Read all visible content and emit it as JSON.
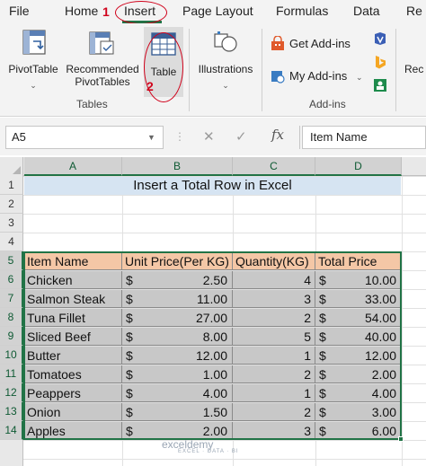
{
  "ribbon": {
    "tabs": [
      {
        "label": "File"
      },
      {
        "label": "Home"
      },
      {
        "label": "Insert"
      },
      {
        "label": "Page Layout"
      },
      {
        "label": "Formulas"
      },
      {
        "label": "Data"
      },
      {
        "label": "Re"
      }
    ],
    "active_tab": "Insert",
    "step1": "1",
    "step2": "2",
    "buttons": {
      "pivottable": "PivotTable",
      "recommended_l1": "Recommended",
      "recommended_l2": "PivotTables",
      "table": "Table",
      "illustrations": "Illustrations",
      "get_addins": "Get Add-ins",
      "my_addins": "My Add-ins",
      "rec": "Rec"
    },
    "groups": {
      "tables": "Tables",
      "addins": "Add-ins"
    },
    "icons": {
      "pivottable": "pivottable-icon",
      "recommended": "recommended-pivottables-icon",
      "table": "table-icon",
      "illustrations": "illustrations-icon",
      "get_addins": "store-icon",
      "my_addins": "my-addins-icon",
      "visio": "visio-icon",
      "bing": "bing-maps-icon",
      "people": "people-graph-icon"
    }
  },
  "formula_bar": {
    "name_box": "A5",
    "cancel_icon": "✕",
    "enter_icon": "✓",
    "fx_label": "fx",
    "formula": "Item Name"
  },
  "grid": {
    "columns": [
      "A",
      "B",
      "C",
      "D"
    ],
    "rows": [
      "1",
      "2",
      "3",
      "4",
      "5",
      "6",
      "7",
      "8",
      "9",
      "10",
      "11",
      "12",
      "13",
      "14"
    ],
    "title": "Insert a Total Row in Excel",
    "headers": [
      "Item Name",
      "Unit Price(Per KG)",
      "Quantity(KG)",
      "Total Price"
    ],
    "currency": "$",
    "data": [
      {
        "item": "Chicken",
        "price": "2.50",
        "qty": "4",
        "total": "10.00"
      },
      {
        "item": "Salmon Steak",
        "price": "11.00",
        "qty": "3",
        "total": "33.00"
      },
      {
        "item": "Tuna Fillet",
        "price": "27.00",
        "qty": "2",
        "total": "54.00"
      },
      {
        "item": "Sliced Beef",
        "price": "8.00",
        "qty": "5",
        "total": "40.00"
      },
      {
        "item": "Butter",
        "price": "12.00",
        "qty": "1",
        "total": "12.00"
      },
      {
        "item": "Tomatoes",
        "price": "1.00",
        "qty": "2",
        "total": "2.00"
      },
      {
        "item": "Peappers",
        "price": "4.00",
        "qty": "1",
        "total": "4.00"
      },
      {
        "item": "Onion",
        "price": "1.50",
        "qty": "2",
        "total": "3.00"
      },
      {
        "item": "Apples",
        "price": "2.00",
        "qty": "3",
        "total": "6.00"
      }
    ]
  },
  "watermark": {
    "brand": "exceldemy",
    "tagline": "EXCEL · DATA · BI"
  },
  "colors": {
    "accent": "#217346",
    "highlight": "#d0021b",
    "title_fill": "#d6e4f2",
    "header_fill": "#f4c7a6",
    "data_fill": "#c8c8c8"
  }
}
